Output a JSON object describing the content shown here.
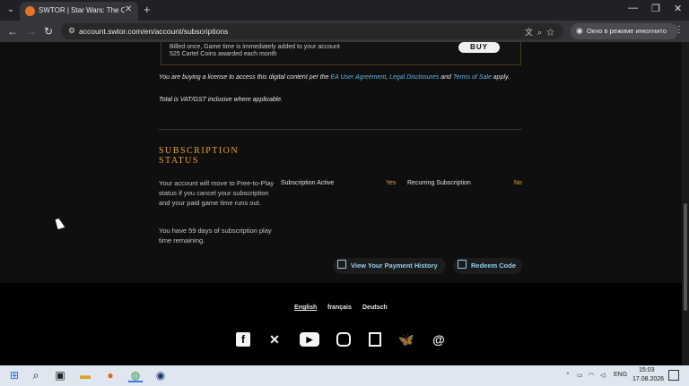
{
  "browser": {
    "tab_title": "SWTOR | Star Wars: The Old Re",
    "url": "account.swtor.com/en/account/subscriptions",
    "incognito_label": "Окно в режиме инкогнито"
  },
  "offer": {
    "line1": "Billed once, Game time is immediately added to your account",
    "line2": "525 Cartel Coins awarded each month",
    "buy_label": "BUY"
  },
  "license": {
    "prefix": "You are buying a license to access this digital content per the ",
    "link1": "EA User Agreement",
    "sep1": ", ",
    "link2": "Legal Disclosures",
    "sep2": " and ",
    "link3": "Terms of Sale",
    "suffix": " apply.",
    "vat": "Total is VAT/GST inclusive where applicable."
  },
  "subscription": {
    "title": "SUBSCRIPTION STATUS",
    "text1": "Your account will move to Free-to-Play status if you cancel your subscription and your paid game time runs out.",
    "text2": "You have 59 days of subscription play time remaining.",
    "active_label": "Subscription Active",
    "active_value": "Yes",
    "recurring_label": "Recurring Subscription",
    "recurring_value": "No",
    "history_label": "View Your Payment History",
    "redeem_label": "Redeem Code"
  },
  "footer": {
    "languages": [
      "English",
      "français",
      "Deutsch"
    ]
  },
  "taskbar": {
    "lang": "ENG",
    "time": "15:03",
    "date": "17.08.2026"
  }
}
